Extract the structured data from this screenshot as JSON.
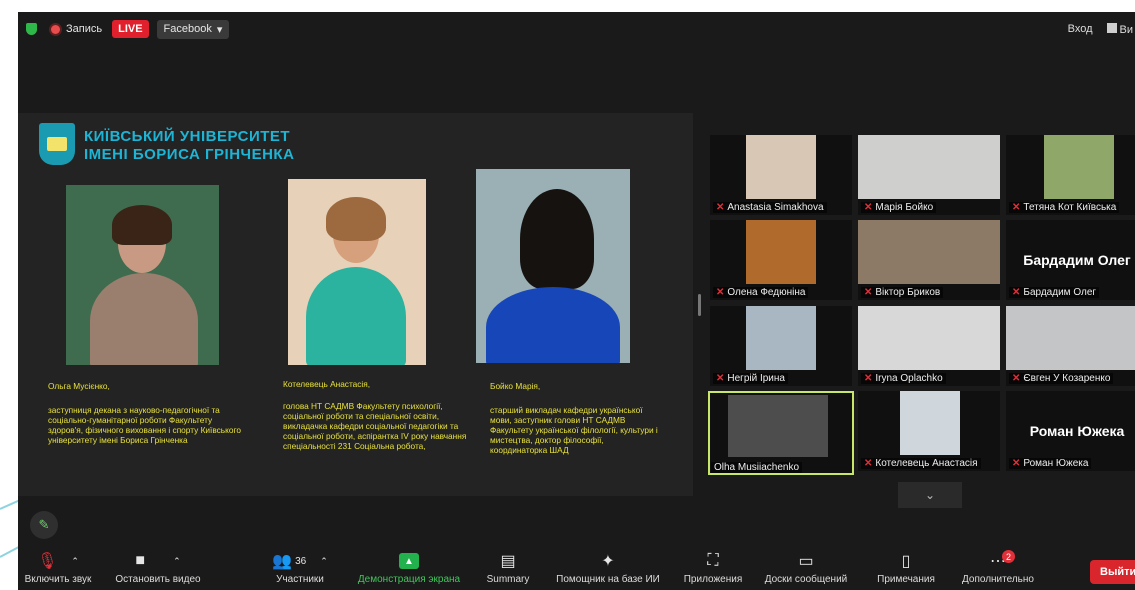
{
  "topbar": {
    "record_label": "Запись",
    "live_label": "LIVE",
    "stream_target": "Facebook",
    "signin_label": "Вход",
    "view_label": "Ви"
  },
  "slide": {
    "university_line1": "КИЇВСЬКИЙ УНІВЕРСИТЕТ",
    "university_line2": "ІМЕНІ БОРИСА ГРІНЧЕНКА",
    "people": [
      {
        "name": "Ольга Мусієнко,",
        "role": "заступниця декана з науково-педагогічної та соціально-гуманітарної роботи Факультету здоров'я, фізичного виховання і спорту Київського університету імені Бориса Грінченка"
      },
      {
        "name": "Котелевець Анастасія,",
        "role": "голова НТ САДМВ Факультету психології, соціальної роботи та спеціальної освіти, викладачка кафедри соціальної педагогіки та соціальної роботи, аспірантка IV року навчання спеціальності 231 Соціальна робота,"
      },
      {
        "name": "Бойко Марія,",
        "role": "старший викладач кафедри української мови, заступник голови НТ САДМВ Факультету української філології, культури і мистецтва, доктор філософії, координаторка ШАД"
      }
    ]
  },
  "participants": [
    {
      "name": "Anastasia Simakhova"
    },
    {
      "name": "Марія Бойко"
    },
    {
      "name": "Тетяна Кот Київська"
    },
    {
      "name": "Олена Федюніна"
    },
    {
      "name": "Віктор Бриков"
    },
    {
      "name": "Бардадим Олег",
      "display": "Бардадим Олег"
    },
    {
      "name": "Негрій Ірина"
    },
    {
      "name": "Iryna Oplachko"
    },
    {
      "name": "Євген У Козаренко"
    },
    {
      "name": "Olha Musiiachenko"
    },
    {
      "name": "Котелевець Анастасія"
    },
    {
      "name": "Роман Южека",
      "display": "Роман Южека"
    }
  ],
  "toolbar": {
    "mute_label": "Включить звук",
    "video_label": "Остановить видео",
    "participants_label": "Участники",
    "participants_count": "36",
    "share_label": "Демонстрация экрана",
    "summary_label": "Summary",
    "ai_label": "Помощник на базе ИИ",
    "apps_label": "Приложения",
    "whiteboard_label": "Доски сообщений",
    "notes_label": "Примечания",
    "more_label": "Дополнительно",
    "more_badge": "2",
    "leave_label": "Выйти"
  },
  "colors": {
    "accent_green": "#3fc65a",
    "live_red": "#e0202c",
    "caption_yellow": "#e8e23a",
    "university_blue": "#1db5d6"
  }
}
